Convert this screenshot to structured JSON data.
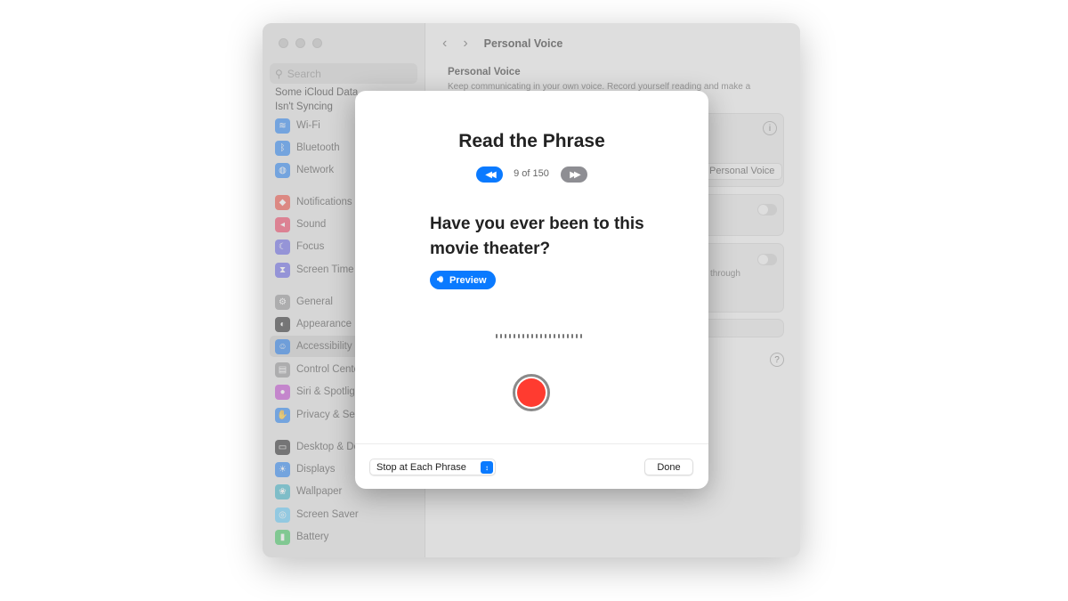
{
  "window": {
    "search_placeholder": "Search",
    "sidebar_notice": [
      "Some iCloud Data",
      "Isn't Syncing"
    ],
    "sidebar_items": [
      {
        "label": "Wi-Fi",
        "icon": "wifi-icon",
        "color": "#1a7cf5"
      },
      {
        "label": "Bluetooth",
        "icon": "bluetooth-icon",
        "color": "#1a7cf5"
      },
      {
        "label": "Network",
        "icon": "globe-icon",
        "color": "#1a7cf5"
      },
      {
        "label": "Notifications",
        "icon": "bell-icon",
        "color": "#f0453a"
      },
      {
        "label": "Sound",
        "icon": "speaker-icon",
        "color": "#f0365a"
      },
      {
        "label": "Focus",
        "icon": "moon-icon",
        "color": "#5e5ce6"
      },
      {
        "label": "Screen Time",
        "icon": "hourglass-icon",
        "color": "#5e5ce6"
      },
      {
        "label": "General",
        "icon": "gear-icon",
        "color": "#8e8e93"
      },
      {
        "label": "Appearance",
        "icon": "appearance-icon",
        "color": "#1c1c1e"
      },
      {
        "label": "Accessibility",
        "icon": "accessibility-icon",
        "color": "#1a7cf5",
        "selected": true
      },
      {
        "label": "Control Center",
        "icon": "control-center-icon",
        "color": "#8e8e93"
      },
      {
        "label": "Siri & Spotlight",
        "icon": "siri-icon",
        "color": "#c03fd0"
      },
      {
        "label": "Privacy & Security",
        "icon": "hand-icon",
        "color": "#1a7cf5"
      },
      {
        "label": "Desktop & Dock",
        "icon": "dock-icon",
        "color": "#1c1c1e"
      },
      {
        "label": "Displays",
        "icon": "sun-icon",
        "color": "#1a7cf5"
      },
      {
        "label": "Wallpaper",
        "icon": "wallpaper-icon",
        "color": "#30b0c7"
      },
      {
        "label": "Screen Saver",
        "icon": "screensaver-icon",
        "color": "#5ac8fa"
      },
      {
        "label": "Battery",
        "icon": "battery-icon",
        "color": "#34c759"
      }
    ],
    "nav_title": "Personal Voice",
    "section_title": "Personal Voice",
    "section_desc": "Keep communicating in your own voice. Record yourself reading and make a",
    "create_button": "Personal Voice",
    "partial_text": "through"
  },
  "dialog": {
    "title": "Read the Phrase",
    "progress": "9 of 150",
    "current": 9,
    "total": 150,
    "phrase": "Have you ever been to this movie theater?",
    "preview_label": "Preview",
    "mode_select": "Stop at Each Phrase",
    "done_label": "Done",
    "accent": "#0a7aff",
    "record_color": "#ff3b30"
  }
}
